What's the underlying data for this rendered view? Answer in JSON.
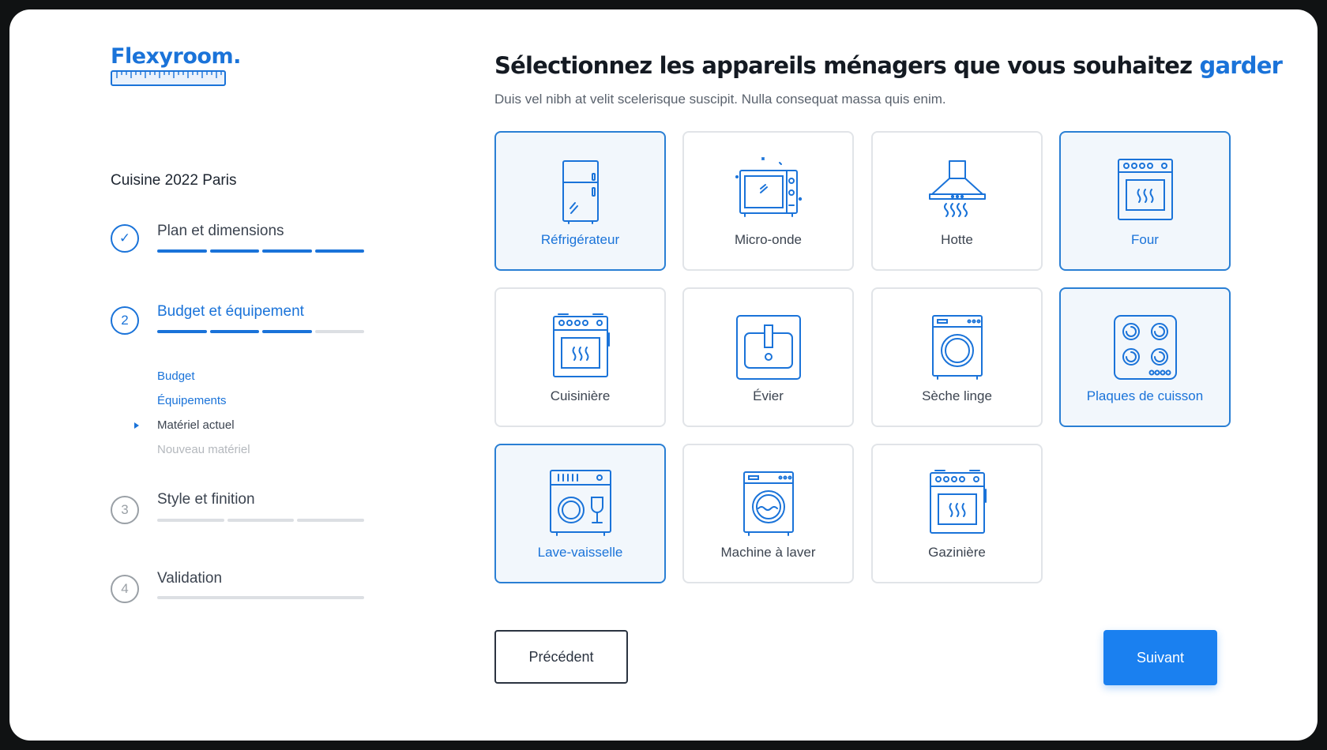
{
  "logo": {
    "text": "Flexyroom."
  },
  "project": {
    "name": "Cuisine 2022 Paris"
  },
  "steps": [
    {
      "number": "✓",
      "title": "Plan et dimensions",
      "status": "done",
      "progress": 1.0
    },
    {
      "number": "2",
      "title": "Budget et équipement",
      "status": "active",
      "progress": 0.75,
      "substeps": [
        {
          "label": "Budget",
          "state": "done"
        },
        {
          "label": "Équipements",
          "state": "done"
        },
        {
          "label": "Matériel actuel",
          "state": "current"
        },
        {
          "label": "Nouveau matériel",
          "state": "pending"
        }
      ]
    },
    {
      "number": "3",
      "title": "Style et finition",
      "status": "pending",
      "progress": 0
    },
    {
      "number": "4",
      "title": "Validation",
      "status": "pending",
      "progress": 0
    }
  ],
  "main": {
    "heading": "Sélectionnez les appareils ménagers que vous souhaitez",
    "heading_accent": "garder",
    "subtitle": "Duis vel nibh at velit scelerisque suscipit. Nulla consequat massa quis enim."
  },
  "appliances": [
    {
      "label": "Réfrigérateur",
      "icon": "fridge-icon",
      "selected": true
    },
    {
      "label": "Micro-onde",
      "icon": "microwave-icon",
      "selected": false
    },
    {
      "label": "Hotte",
      "icon": "hood-icon",
      "selected": false
    },
    {
      "label": "Four",
      "icon": "oven-icon",
      "selected": true
    },
    {
      "label": "Cuisinière",
      "icon": "stove-icon",
      "selected": false
    },
    {
      "label": "Évier",
      "icon": "sink-icon",
      "selected": false
    },
    {
      "label": "Sèche linge",
      "icon": "dryer-icon",
      "selected": false
    },
    {
      "label": "Plaques de cuisson",
      "icon": "cooktop-icon",
      "selected": true
    },
    {
      "label": "Lave-vaisselle",
      "icon": "dishwasher-icon",
      "selected": true
    },
    {
      "label": "Machine à laver",
      "icon": "washing-machine-icon",
      "selected": false
    },
    {
      "label": "Gazinière",
      "icon": "gas-stove-icon",
      "selected": false
    }
  ],
  "buttons": {
    "previous": "Précédent",
    "next": "Suivant"
  },
  "colors": {
    "accent": "#1a73d9",
    "button": "#1a80f0",
    "selected_bg": "#f2f7fc"
  }
}
